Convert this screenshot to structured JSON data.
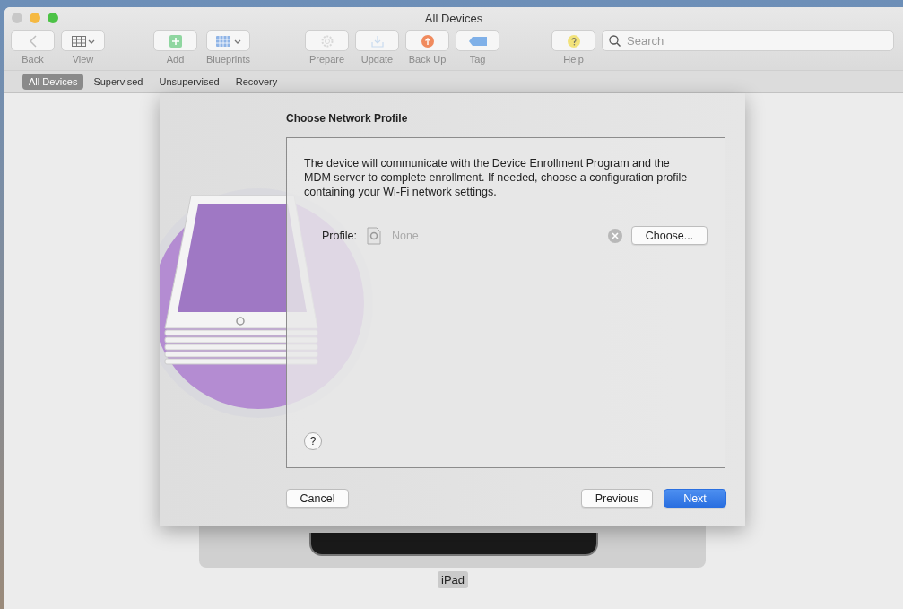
{
  "window": {
    "title": "All Devices"
  },
  "toolbar": [
    {
      "kind": "back",
      "label": "Back",
      "disabled": true
    },
    {
      "kind": "view",
      "label": "View",
      "disabled": false
    },
    {
      "kind": "add",
      "label": "Add",
      "disabled": false
    },
    {
      "kind": "blueprints",
      "label": "Blueprints",
      "disabled": false
    },
    {
      "kind": "prepare",
      "label": "Prepare",
      "disabled": true
    },
    {
      "kind": "update",
      "label": "Update",
      "disabled": true
    },
    {
      "kind": "backup",
      "label": "Back Up",
      "disabled": false
    },
    {
      "kind": "tag",
      "label": "Tag",
      "disabled": false
    },
    {
      "kind": "help",
      "label": "Help",
      "disabled": false
    }
  ],
  "search": {
    "placeholder": "Search"
  },
  "filter_tabs": [
    {
      "label": "All Devices",
      "selected": true
    },
    {
      "label": "Supervised",
      "selected": false
    },
    {
      "label": "Unsupervised",
      "selected": false
    },
    {
      "label": "Recovery",
      "selected": false
    }
  ],
  "device": {
    "name": "iPad"
  },
  "sheet": {
    "title": "Choose Network Profile",
    "description": "The device will communicate with the Device Enrollment Program and the MDM server to complete enrollment. If needed, choose a configuration profile containing your Wi-Fi network settings.",
    "profile_label": "Profile:",
    "profile_value": "None",
    "choose_button": "Choose...",
    "help_button": "?",
    "cancel_button": "Cancel",
    "previous_button": "Previous",
    "next_button": "Next"
  }
}
